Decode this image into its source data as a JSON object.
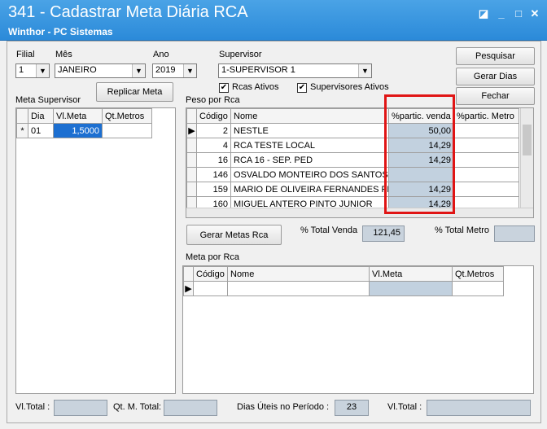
{
  "window": {
    "title": "341 - Cadastrar Meta Diária RCA",
    "subtitle": "Winthor - PC Sistemas"
  },
  "filters": {
    "filial_label": "Filial",
    "filial_value": "1",
    "mes_label": "Mês",
    "mes_value": "JANEIRO",
    "ano_label": "Ano",
    "ano_value": "2019",
    "supervisor_label": "Supervisor",
    "supervisor_value": "1-SUPERVISOR 1",
    "rcas_ativos_label": "Rcas Ativos",
    "rcas_ativos_checked": true,
    "supervisores_ativos_label": "Supervisores Ativos",
    "supervisores_ativos_checked": true
  },
  "buttons": {
    "pesquisar": "Pesquisar",
    "gerar_dias": "Gerar Dias",
    "fechar": "Fechar",
    "replicar_meta": "Replicar Meta",
    "gerar_metas_rca": "Gerar Metas Rca"
  },
  "meta_supervisor": {
    "title": "Meta Supervisor",
    "columns": [
      "Dia",
      "Vl.Meta",
      "Qt.Metros"
    ],
    "row_marker": "*",
    "rows": [
      {
        "dia": "01",
        "vl_meta": "1,5000",
        "qt_metros": ""
      }
    ]
  },
  "peso_por_rca": {
    "title": "Peso por Rca",
    "columns": [
      "Código",
      "Nome",
      "%partic. venda",
      "%partic. Metro"
    ],
    "rows": [
      {
        "codigo": "2",
        "nome": "NESTLE",
        "venda": "50,00",
        "metro": ""
      },
      {
        "codigo": "4",
        "nome": "RCA TESTE LOCAL",
        "venda": "14,29",
        "metro": ""
      },
      {
        "codigo": "16",
        "nome": "RCA 16 - SEP. PED",
        "venda": "14,29",
        "metro": ""
      },
      {
        "codigo": "146",
        "nome": "OSVALDO MONTEIRO DOS SANTOS",
        "venda": "",
        "metro": ""
      },
      {
        "codigo": "159",
        "nome": "MARIO DE OLIVEIRA FERNANDES FILHO",
        "venda": "14,29",
        "metro": ""
      },
      {
        "codigo": "160",
        "nome": "MIGUEL ANTERO PINTO JUNIOR",
        "venda": "14,29",
        "metro": ""
      }
    ]
  },
  "totals": {
    "total_venda_label": "% Total Venda",
    "total_venda_value": "121,45",
    "total_metro_label": "% Total Metro",
    "total_metro_value": ""
  },
  "meta_por_rca": {
    "title": "Meta por Rca",
    "columns": [
      "Código",
      "Nome",
      "Vl.Meta",
      "Qt.Metros"
    ]
  },
  "footer": {
    "vl_total_label": "Vl.Total :",
    "qt_m_total_label": "Qt. M. Total:",
    "dias_uteis_label": "Dias Úteis no Período :",
    "dias_uteis_value": "23",
    "vl_total2_label": "Vl.Total :"
  },
  "colors": {
    "titlebar": "#2b8ad9",
    "highlight_border": "#e01515",
    "selected_cell": "#1c6fd1"
  }
}
